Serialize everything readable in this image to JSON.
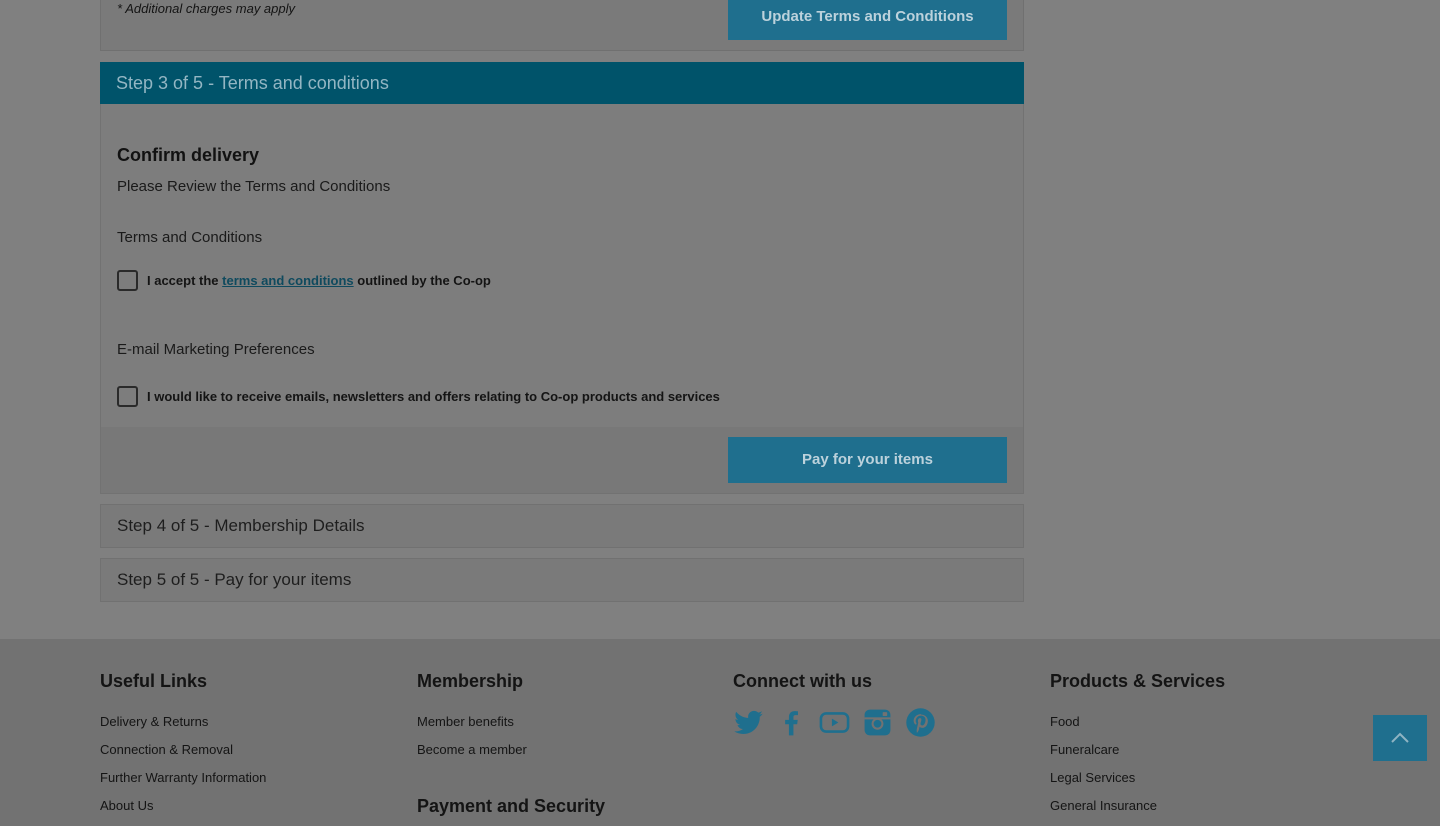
{
  "previous_step": {
    "note": "* Additional charges may apply",
    "update_button": "Update Terms and Conditions"
  },
  "step3": {
    "header": "Step 3 of 5 - Terms and conditions",
    "title": "Confirm delivery",
    "review_text": "Please Review the Terms and Conditions",
    "terms_label": "Terms and Conditions",
    "accept_prefix": "I accept the",
    "accept_link": "terms and conditions",
    "accept_suffix": "outlined by the Co-op",
    "email_label": "E-mail Marketing Preferences",
    "email_opt_in": "I would like to receive emails, newsletters and offers relating to Co-op products and services",
    "pay_button": "Pay for your items"
  },
  "step4": {
    "header": "Step 4 of 5 - Membership Details"
  },
  "step5": {
    "header": "Step 5 of 5 - Pay for your items"
  },
  "footer": {
    "useful_links": {
      "title": "Useful Links",
      "items": [
        "Delivery & Returns",
        "Connection & Removal",
        "Further Warranty Information",
        "About Us"
      ]
    },
    "membership": {
      "title": "Membership",
      "items": [
        "Member benefits",
        "Become a member"
      ]
    },
    "payment_security": {
      "title": "Payment and Security"
    },
    "connect": {
      "title": "Connect with us",
      "icons": [
        "twitter-icon",
        "facebook-icon",
        "youtube-icon",
        "instagram-icon",
        "pinterest-icon"
      ]
    },
    "products": {
      "title": "Products & Services",
      "items": [
        "Food",
        "Funeralcare",
        "Legal Services",
        "General Insurance"
      ]
    }
  },
  "colors": {
    "accent": "#1f6f8e",
    "header": "#00536a",
    "overlay_bg": "#808080"
  }
}
